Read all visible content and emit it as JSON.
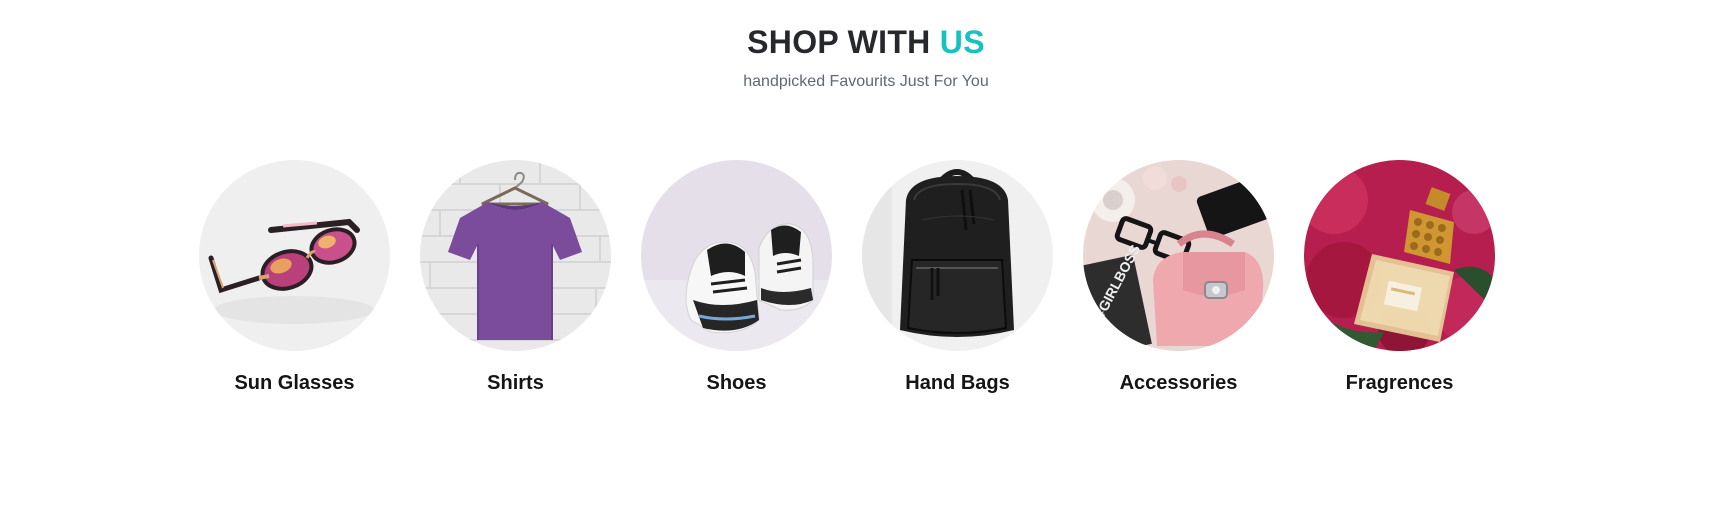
{
  "section": {
    "title_main": "SHOP WITH",
    "title_accent": "US",
    "subtitle": "handpicked Favourits Just For You",
    "accent_color": "#14c3bd"
  },
  "categories": [
    {
      "label": "Sun Glasses",
      "icon": "sunglasses-image"
    },
    {
      "label": "Shirts",
      "icon": "t-shirt-image"
    },
    {
      "label": "Shoes",
      "icon": "sneakers-image"
    },
    {
      "label": "Hand Bags",
      "icon": "backpack-image"
    },
    {
      "label": "Accessories",
      "icon": "accessories-image"
    },
    {
      "label": "Fragrences",
      "icon": "perfume-image"
    }
  ]
}
